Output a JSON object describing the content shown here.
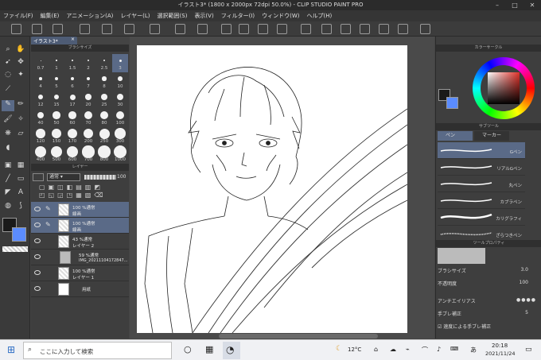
{
  "window": {
    "title": "イラスト3* (1800 x 2000px 72dpi 50.0%) - CLIP STUDIO PAINT PRO"
  },
  "menu": [
    "ファイル(F)",
    "編集(E)",
    "アニメーション(A)",
    "レイヤー(L)",
    "選択範囲(S)",
    "表示(V)",
    "フィルター(I)",
    "ウィンドウ(W)",
    "ヘルプ(H)"
  ],
  "canvas_tab": {
    "label": "イラスト3*"
  },
  "brush_size": {
    "title": "ブラシサイズ",
    "labels": [
      "0.7",
      "1",
      "1.5",
      "2",
      "2.5",
      "3",
      "4",
      "5",
      "6",
      "7",
      "8",
      "10",
      "12",
      "15",
      "17",
      "20",
      "25",
      "30",
      "40",
      "50",
      "60",
      "70",
      "80",
      "100",
      "120",
      "150",
      "170",
      "200",
      "250",
      "300",
      "400",
      "500",
      "600",
      "700",
      "800",
      "1000"
    ],
    "selected": "3"
  },
  "layer_panel": {
    "title": "レイヤー",
    "blend": "通常",
    "opacity": "100",
    "layers": [
      {
        "line1": "100 %通常",
        "line2": "線画",
        "selected": true
      },
      {
        "line1": "100 %通常",
        "line2": "線画",
        "selected": true
      },
      {
        "line1": "43 %通常",
        "line2": "レイヤー 2",
        "selected": false
      },
      {
        "line1": "59 %通常",
        "line2": "IMG_20211104172847...",
        "selected": false
      },
      {
        "line1": "100 %通常",
        "line2": "レイヤー 1",
        "selected": false
      },
      {
        "line1": "用紙",
        "line2": "",
        "selected": false
      }
    ]
  },
  "color_circle": {
    "title": "カラーサークル",
    "hue_color": "#e0322a",
    "main_color": "#1a1a1a",
    "sub_color": "#5b8cff"
  },
  "subtool": {
    "title": "サブツール",
    "tabs": [
      "ペン",
      "マーカー"
    ],
    "items": [
      "Gペン",
      "リアルGペン",
      "丸ペン",
      "カブラペン",
      "カリグラフィ",
      "ざらつきペン"
    ],
    "selected": "Gペン"
  },
  "tool_property": {
    "title": "ツールプロパティ",
    "brush_size_label": "ブラシサイズ",
    "brush_size_value": "3.0",
    "opacity_label": "不透明度",
    "opacity_value": "100",
    "antialias_label": "アンチエイリアス",
    "stabilization_label": "手ブレ補正",
    "stabilization_value": "5",
    "speed_label": "速度による手ブレ補正"
  },
  "taskbar": {
    "search_placeholder": "ここに入力して検索",
    "weather": "12°C",
    "ime": "あ",
    "time": "20:18",
    "date": "2021/11/24"
  }
}
